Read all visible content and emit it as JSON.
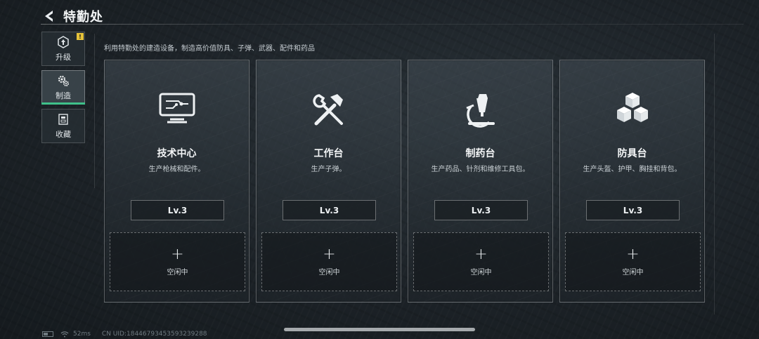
{
  "header": {
    "title": "特勤处"
  },
  "sidebar": {
    "items": [
      {
        "label": "升级",
        "icon": "upgrade-icon",
        "badge": "!"
      },
      {
        "label": "制造",
        "icon": "manufacture-gear-icon",
        "active": true
      },
      {
        "label": "收藏",
        "icon": "collection-icon"
      }
    ]
  },
  "description": "利用特勤处的建造设备，制造高价值防具、子弹、武器、配件和药品",
  "stations": [
    {
      "name": "技术中心",
      "desc": "生产枪械和配件。",
      "level": "Lv.3",
      "slot": "空闲中",
      "icon": "computer-monitor-icon"
    },
    {
      "name": "工作台",
      "desc": "生产子弹。",
      "level": "Lv.3",
      "slot": "空闲中",
      "icon": "hammer-wrench-icon"
    },
    {
      "name": "制药台",
      "desc": "生产药品、针剂和维修工具包。",
      "level": "Lv.3",
      "slot": "空闲中",
      "icon": "microscope-icon"
    },
    {
      "name": "防具台",
      "desc": "生产头盔、护甲、胸挂和背包。",
      "level": "Lv.3",
      "slot": "空闲中",
      "icon": "cubes-icon"
    }
  ],
  "slot_plus": "+",
  "footer": {
    "ping": "52ms",
    "uid": "CN UID:18446793453593239288"
  },
  "colors": {
    "accent": "#3fc08a",
    "badge": "#e5c23a"
  }
}
